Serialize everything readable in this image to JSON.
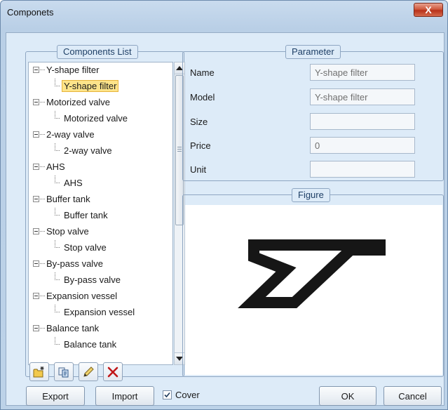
{
  "window": {
    "title": "Componets",
    "close_label": "X"
  },
  "components_list": {
    "legend": "Components List",
    "tree": [
      {
        "parent": "Y-shape filter",
        "child": "Y-shape filter",
        "selected": true
      },
      {
        "parent": "Motorized valve",
        "child": "Motorized valve"
      },
      {
        "parent": "2-way valve",
        "child": "2-way valve"
      },
      {
        "parent": "AHS",
        "child": "AHS"
      },
      {
        "parent": "Buffer tank",
        "child": "Buffer tank"
      },
      {
        "parent": "Stop valve",
        "child": "Stop valve"
      },
      {
        "parent": "By-pass valve",
        "child": "By-pass valve"
      },
      {
        "parent": "Expansion vessel",
        "child": "Expansion vessel"
      },
      {
        "parent": "Balance tank",
        "child": "Balance tank"
      }
    ],
    "toolbar": [
      {
        "name": "new-folder-button",
        "icon": "new-folder-icon"
      },
      {
        "name": "copy-button",
        "icon": "copy-icon"
      },
      {
        "name": "edit-button",
        "icon": "pencil-icon"
      },
      {
        "name": "delete-button",
        "icon": "delete-x-icon"
      }
    ]
  },
  "parameter": {
    "legend": "Parameter",
    "fields": [
      {
        "label": "Name",
        "value": "Y-shape filter"
      },
      {
        "label": "Model",
        "value": "Y-shape filter"
      },
      {
        "label": "Size",
        "value": ""
      },
      {
        "label": "Price",
        "value": "0"
      },
      {
        "label": "Unit",
        "value": ""
      }
    ]
  },
  "figure": {
    "legend": "Figure",
    "image": "y-shape-filter-symbol"
  },
  "buttons": {
    "export": "Export",
    "import": "Import",
    "cover": "Cover",
    "cover_checked": true,
    "ok": "OK",
    "cancel": "Cancel"
  },
  "colors": {
    "selection_fill": "#fde48a",
    "selection_border": "#e6b43c",
    "close_button": "#c7412a",
    "delete_icon": "#c0181a"
  }
}
